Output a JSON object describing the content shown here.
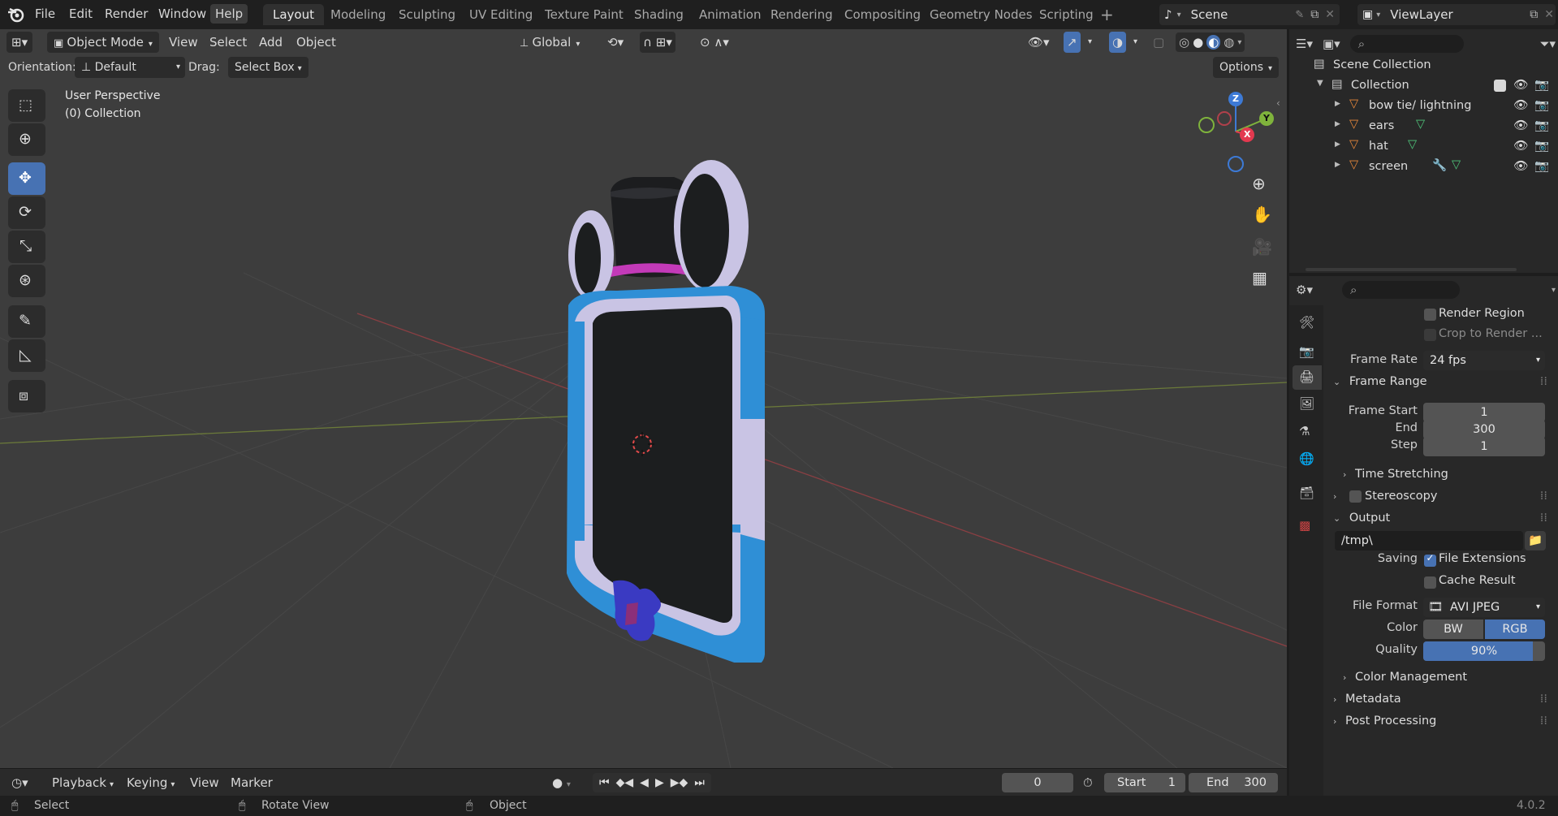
{
  "menu": {
    "file": "File",
    "edit": "Edit",
    "render": "Render",
    "window": "Window",
    "help": "Help"
  },
  "workspaces": [
    "Layout",
    "Modeling",
    "Sculpting",
    "UV Editing",
    "Texture Paint",
    "Shading",
    "Animation",
    "Rendering",
    "Compositing",
    "Geometry Nodes",
    "Scripting"
  ],
  "scene": {
    "name": "Scene",
    "view_layer": "ViewLayer"
  },
  "viewport": {
    "mode": "Object Mode",
    "menus": [
      "View",
      "Select",
      "Add",
      "Object"
    ],
    "transform_orientation": "Global",
    "orientation_label": "Orientation:",
    "orientation_value": "Default",
    "drag_label": "Drag:",
    "drag_value": "Select Box",
    "options": "Options",
    "perspective": "User Perspective",
    "collection_info": "(0) Collection",
    "gizmo": {
      "z": "Z",
      "y": "Y",
      "x": "X"
    }
  },
  "outliner": {
    "root": "Scene Collection",
    "collection": "Collection",
    "objects": [
      {
        "name": "bow tie/ lightning"
      },
      {
        "name": "ears"
      },
      {
        "name": "hat"
      },
      {
        "name": "screen"
      }
    ]
  },
  "properties": {
    "render_region": "Render Region",
    "crop_to_render": "Crop to Render ...",
    "frame_rate_label": "Frame Rate",
    "frame_rate": "24 fps",
    "frame_range": "Frame Range",
    "frame_start_label": "Frame Start",
    "frame_start": "1",
    "end_label": "End",
    "end": "300",
    "step_label": "Step",
    "step": "1",
    "time_stretching": "Time Stretching",
    "stereoscopy": "Stereoscopy",
    "output": "Output",
    "output_path": "/tmp\\",
    "saving_label": "Saving",
    "file_extensions": "File Extensions",
    "cache_result": "Cache Result",
    "file_format_label": "File Format",
    "file_format": "AVI JPEG",
    "color_label": "Color",
    "color_bw": "BW",
    "color_rgb": "RGB",
    "quality_label": "Quality",
    "quality": "90%",
    "quality_fraction": 0.9,
    "color_management": "Color Management",
    "metadata": "Metadata",
    "post_processing": "Post Processing"
  },
  "timeline": {
    "playback": "Playback",
    "keying": "Keying",
    "view": "View",
    "marker": "Marker",
    "current_frame": "0",
    "start_label": "Start",
    "start": "1",
    "end_label": "End",
    "end": "300"
  },
  "status": {
    "select": "Select",
    "rotate": "Rotate View",
    "object": "Object",
    "version": "4.0.2"
  },
  "colors": {
    "accent": "#4772b3",
    "frame_blue": "#2f8fd6",
    "frame_lavender": "#c9c4e4",
    "screen": "#1c1e1f",
    "hat_band": "#c33ab8",
    "bow": "#3a3ac2"
  }
}
